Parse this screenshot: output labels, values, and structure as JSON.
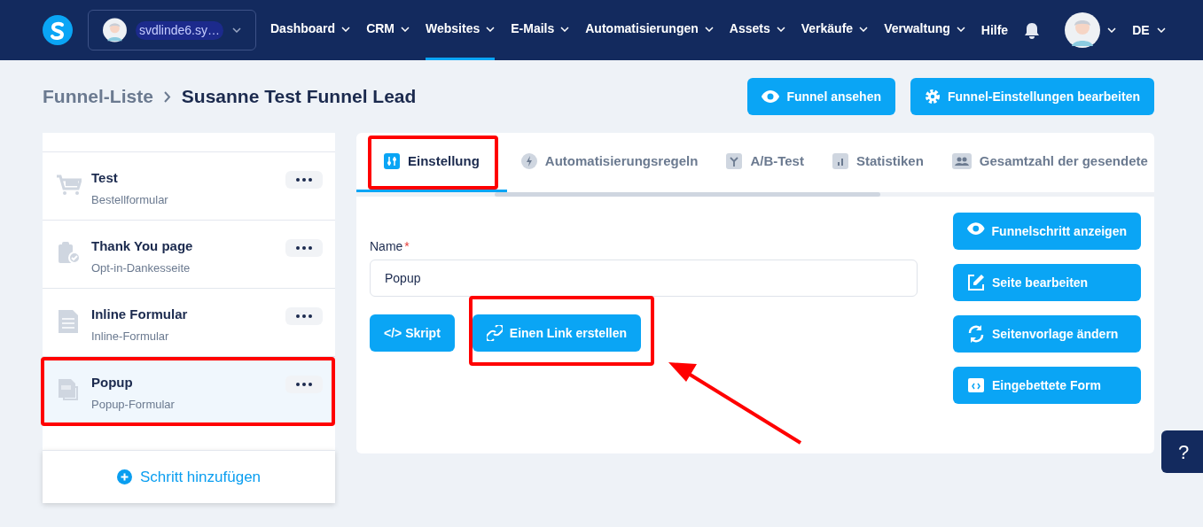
{
  "nav": {
    "account": "svdlinde6.sy…",
    "items": [
      {
        "label": "Dashboard",
        "selected": false
      },
      {
        "label": "CRM",
        "selected": false
      },
      {
        "label": "Websites",
        "selected": true
      },
      {
        "label": "E-Mails",
        "selected": false
      },
      {
        "label": "Automatisierungen",
        "selected": false
      },
      {
        "label": "Assets",
        "selected": false
      },
      {
        "label": "Verkäufe",
        "selected": false
      },
      {
        "label": "Verwaltung",
        "selected": false
      }
    ],
    "help": "Hilfe",
    "language": "DE"
  },
  "breadcrumb": {
    "parent": "Funnel-Liste",
    "current": "Susanne Test Funnel Lead"
  },
  "header_buttons": [
    "Funnel ansehen",
    "Funnel-Einstellungen bearbeiten"
  ],
  "steps": [
    {
      "kind": "cart",
      "title": "Test",
      "subtitle": "Bestellformular",
      "selected": false
    },
    {
      "kind": "clipboard",
      "title": "Thank You page",
      "subtitle": "Opt-in-Dankesseite",
      "selected": false
    },
    {
      "kind": "document",
      "title": "Inline Formular",
      "subtitle": "Inline-Formular",
      "selected": false
    },
    {
      "kind": "popup",
      "title": "Popup",
      "subtitle": "Popup-Formular",
      "selected": true
    }
  ],
  "add_step": "Schritt hinzufügen",
  "tabs": [
    {
      "kind": "sliders",
      "label": "Einstellung",
      "selected": true
    },
    {
      "kind": "bolt",
      "label": "Automatisierungsregeln",
      "selected": false
    },
    {
      "kind": "split",
      "label": "A/B-Test",
      "selected": false
    },
    {
      "kind": "chart",
      "label": "Statistiken",
      "selected": false
    },
    {
      "kind": "users",
      "label": "Gesamtzahl der gesendete",
      "selected": false
    }
  ],
  "form": {
    "label": "Name",
    "required_mark": "*",
    "value": "Popup",
    "buttons": [
      "</> Skript",
      "Einen Link erstellen"
    ]
  },
  "side_buttons": [
    {
      "kind": "eye",
      "label": "Funnelschritt anzeigen"
    },
    {
      "kind": "edit",
      "label": "Seite bearbeiten"
    },
    {
      "kind": "refresh",
      "label": "Seitenvorlage ändern"
    },
    {
      "kind": "code",
      "label": "Eingebettete Form"
    }
  ],
  "help_button": "?"
}
